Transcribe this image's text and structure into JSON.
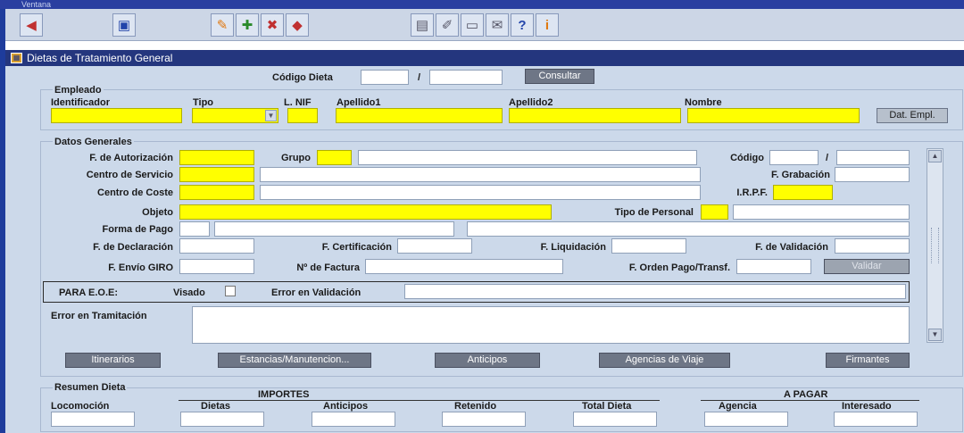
{
  "window": {
    "top_title": "Ventana"
  },
  "toolbar": {
    "buttons": [
      {
        "icon": "exit-icon",
        "glyph": "◀"
      },
      {
        "icon": "save-icon",
        "glyph": "▣"
      },
      {
        "icon": "clear-icon",
        "glyph": "✎"
      },
      {
        "icon": "insert-record-icon",
        "glyph": "✚"
      },
      {
        "icon": "delete-record-icon",
        "glyph": "✖"
      },
      {
        "icon": "eraser-icon",
        "glyph": "◆"
      },
      {
        "icon": "calendar-icon",
        "glyph": "▤"
      },
      {
        "icon": "edit-icon",
        "glyph": "✐"
      },
      {
        "icon": "print-icon",
        "glyph": "▭"
      },
      {
        "icon": "mail-icon",
        "glyph": "✉"
      },
      {
        "icon": "help-icon",
        "glyph": "?"
      },
      {
        "icon": "info-icon",
        "glyph": "i"
      }
    ]
  },
  "form": {
    "title": "Dietas de Tratamiento General",
    "codigo_dieta": {
      "label": "Código Dieta",
      "sep": "/",
      "consultar": "Consultar"
    },
    "empleado": {
      "group_label": "Empleado",
      "identificador": "Identificador",
      "tipo": "Tipo",
      "lnif": "L. NIF",
      "apellido1": "Apellido1",
      "apellido2": "Apellido2",
      "nombre": "Nombre",
      "dat_empl": "Dat. Empl."
    },
    "datos": {
      "group_label": "Datos Generales",
      "f_autorizacion": "F. de Autorización",
      "grupo": "Grupo",
      "codigo": "Código",
      "codigo_sep": "/",
      "centro_servicio": "Centro de Servicio",
      "f_grabacion": "F. Grabación",
      "centro_coste": "Centro de Coste",
      "irpf": "I.R.P.F.",
      "objeto": "Objeto",
      "tipo_personal": "Tipo de Personal",
      "forma_pago": "Forma de Pago",
      "f_declaracion": "F. de Declaración",
      "f_certificacion": "F. Certificación",
      "f_liquidacion": "F. Liquidación",
      "f_validacion": "F. de Validación",
      "f_envio_giro": "F. Envío GIRO",
      "n_factura": "Nº de Factura",
      "f_orden_pago": "F. Orden Pago/Transf.",
      "validar": "Validar",
      "para_eoe": "PARA E.O.E:",
      "visado": "Visado",
      "error_validacion": "Error en Validación",
      "error_tramitacion": "Error en Tramitación"
    },
    "actions": {
      "itinerarios": "Itinerarios",
      "estancias": "Estancias/Manutencion...",
      "anticipos": "Anticipos",
      "agencias": "Agencias de Viaje",
      "firmantes": "Firmantes"
    },
    "resumen": {
      "group_label": "Resumen Dieta",
      "importes": "IMPORTES",
      "a_pagar": "A PAGAR",
      "locomocion": "Locomoción",
      "dietas": "Dietas",
      "anticipos": "Anticipos",
      "retenido": "Retenido",
      "total_dieta": "Total Dieta",
      "agencia": "Agencia",
      "interesado": "Interesado"
    }
  },
  "colors": {
    "required_field": "#ffff00",
    "form_bg": "#ccd9ea",
    "titlebar": "#24367e"
  }
}
